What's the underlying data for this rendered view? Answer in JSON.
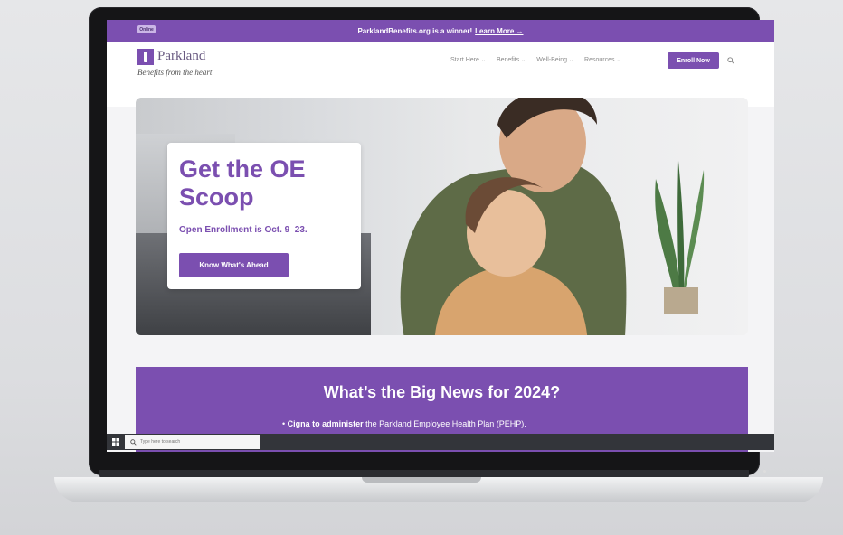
{
  "promo": {
    "tag": "Online",
    "message": "ParklandBenefits.org is a winner!",
    "link": "Learn More →"
  },
  "header": {
    "logo_name": "Parkland",
    "logo_tagline": "Benefits from the heart",
    "nav": [
      {
        "label": "Start Here"
      },
      {
        "label": "Benefits"
      },
      {
        "label": "Well-Being"
      },
      {
        "label": "Resources"
      }
    ],
    "enroll_label": "Enroll Now",
    "search_icon": "search-icon"
  },
  "hero": {
    "title": "Get the OE Scoop",
    "subtitle": "Open Enrollment is Oct. 9–23.",
    "button_label": "Know What's Ahead"
  },
  "news": {
    "title": "What’s the Big News for 2024?",
    "bullet_bold": "Cigna to administer",
    "bullet_rest": " the Parkland Employee Health Plan (PEHP)."
  },
  "taskbar": {
    "search_placeholder": "Type here to search"
  },
  "colors": {
    "brand_purple": "#7b4fb0",
    "taskbar": "#33353a"
  }
}
